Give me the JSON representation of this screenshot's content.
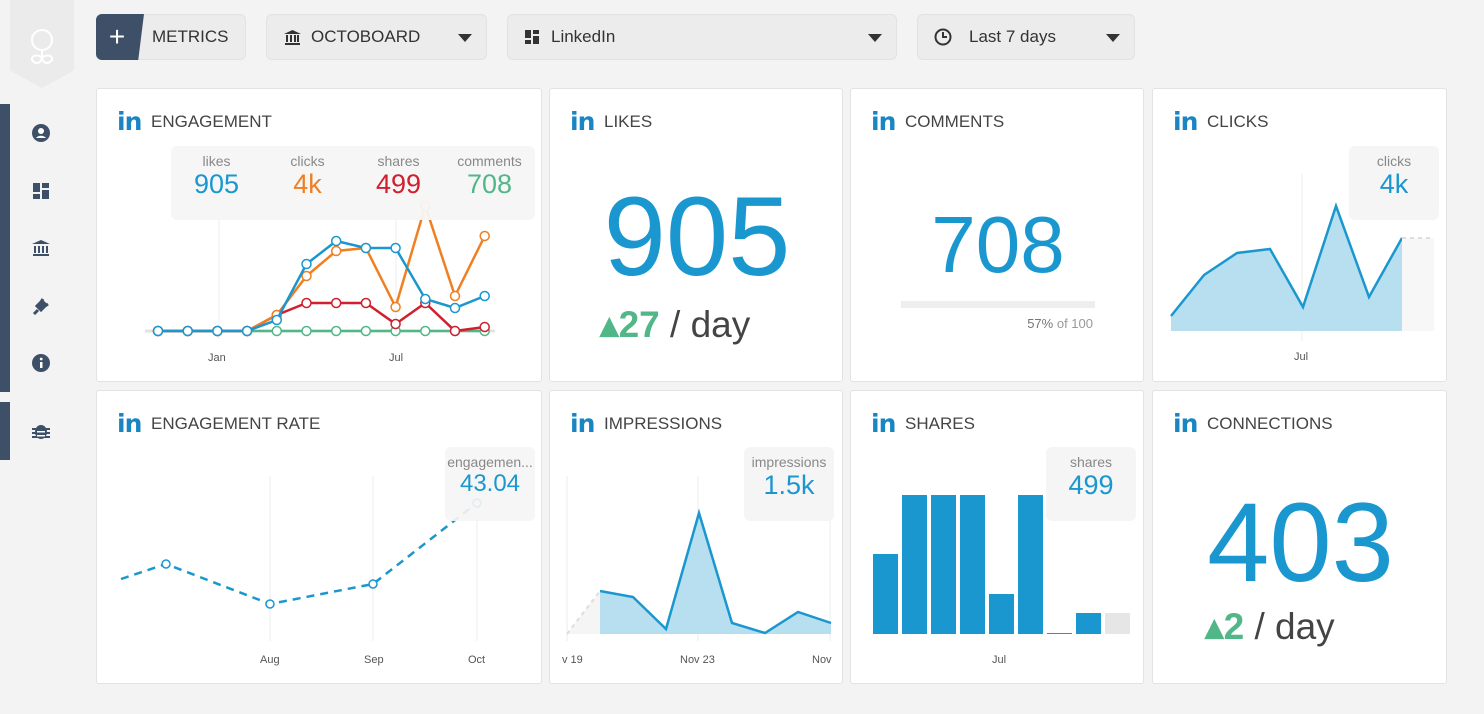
{
  "toolbar": {
    "metrics_label": "METRICS",
    "plus_label": "+",
    "board": "OCTOBOARD",
    "source": "LinkedIn",
    "range": "Last 7 days"
  },
  "sidebar": {
    "items": [
      "user-circle-icon",
      "dashboard-icon",
      "bank-icon",
      "plug-icon",
      "info-icon",
      "bug-icon"
    ]
  },
  "colors": {
    "accent": "#1a97cf",
    "nav": "#3d5068",
    "likes": "#1a97cf",
    "clicks": "#f07f22",
    "shares": "#d0202f",
    "comments": "#52b788",
    "up": "#52b788"
  },
  "engagement": {
    "title": "ENGAGEMENT",
    "network": "in",
    "stats": [
      {
        "label": "likes",
        "value": "905"
      },
      {
        "label": "clicks",
        "value": "4k"
      },
      {
        "label": "shares",
        "value": "499"
      },
      {
        "label": "comments",
        "value": "708"
      }
    ],
    "x_ticks": [
      "Jan",
      "Jul"
    ],
    "series": {
      "likes": [
        0,
        0,
        0,
        0,
        11,
        67,
        90,
        83,
        83,
        32,
        23,
        35
      ],
      "clicks": [
        0,
        0,
        0,
        0,
        16,
        55,
        80,
        83,
        24,
        125,
        35,
        95
      ],
      "shares": [
        0,
        0,
        0,
        0,
        16,
        28,
        28,
        28,
        7,
        28,
        0,
        4
      ],
      "comments": [
        0,
        0,
        0,
        0,
        0,
        0,
        0,
        0,
        0,
        0,
        0,
        0
      ]
    }
  },
  "likes": {
    "title": "LIKES",
    "network": "in",
    "value": "905",
    "delta": "27",
    "per": "/ day"
  },
  "comments": {
    "title": "COMMENTS",
    "network": "in",
    "value": "708",
    "progress_pct": 57,
    "progress_pct_label": "57%",
    "progress_of": "of 100"
  },
  "clicks": {
    "title": "CLICKS",
    "network": "in",
    "tip_label": "clicks",
    "tip_value": "4k",
    "x_ticks": [
      "Jul"
    ],
    "values": [
      15,
      56,
      78,
      82,
      24,
      125,
      34,
      93
    ]
  },
  "engagement_rate": {
    "title": "ENGAGEMENT RATE",
    "network": "in",
    "tip_label": "engagemen...",
    "tip_value": "43.04",
    "x_ticks": [
      "Aug",
      "Sep",
      "Oct"
    ],
    "values": [
      25,
      40,
      0,
      20,
      101
    ]
  },
  "impressions": {
    "title": "IMPRESSIONS",
    "network": "in",
    "tip_label": "impressions",
    "tip_value": "1.5k",
    "x_ticks": [
      "v 19",
      "Nov 23",
      "Nov"
    ],
    "values": [
      43,
      37,
      5,
      121,
      11,
      1,
      22,
      11
    ]
  },
  "shares": {
    "title": "SHARES",
    "network": "in",
    "tip_label": "shares",
    "tip_value": "499",
    "x_ticks": [
      "Jul"
    ],
    "values": [
      80,
      139,
      139,
      139,
      40,
      139,
      1,
      21,
      21
    ]
  },
  "connections": {
    "title": "CONNECTIONS",
    "network": "in",
    "value": "403",
    "delta": "2",
    "per": "/ day"
  }
}
